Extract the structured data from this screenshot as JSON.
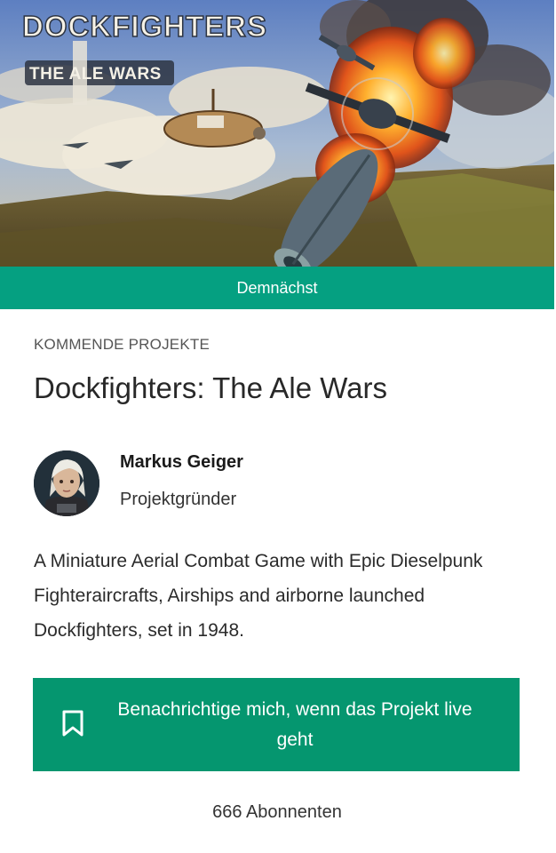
{
  "hero": {
    "logo_title": "DOCKFIGHTERS",
    "logo_subtitle": "THE ALE WARS"
  },
  "status_banner": {
    "label": "Demnächst"
  },
  "project": {
    "category": "KOMMENDE PROJEKTE",
    "title": "Dockfighters: The Ale Wars",
    "description": "A Miniature Aerial Combat Game with Epic Dieselpunk Fighteraircrafts, Airships and airborne launched Dockfighters, set in 1948."
  },
  "creator": {
    "name": "Markus Geiger",
    "role": "Projektgründer"
  },
  "notify_button": {
    "label": "Benachrichtige mich, wenn das Projekt live geht",
    "icon": "bookmark-icon"
  },
  "subscribers": {
    "label": "666 Abonnenten"
  },
  "colors": {
    "banner": "#05a081",
    "button": "#05966f"
  }
}
